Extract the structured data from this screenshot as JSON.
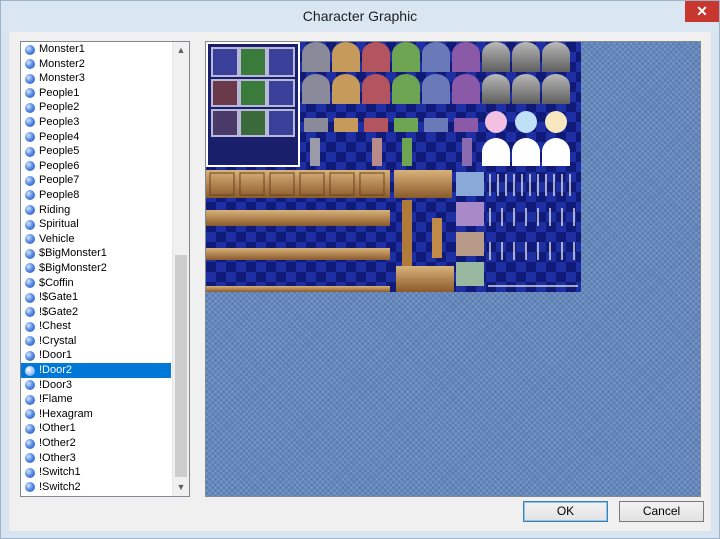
{
  "window": {
    "title": "Character Graphic",
    "close_label": "✕"
  },
  "list": {
    "items": [
      "Monster1",
      "Monster2",
      "Monster3",
      "People1",
      "People2",
      "People3",
      "People4",
      "People5",
      "People6",
      "People7",
      "People8",
      "Riding",
      "Spiritual",
      "Vehicle",
      "$BigMonster1",
      "$BigMonster2",
      "$Coffin",
      "!$Gate1",
      "!$Gate2",
      "!Chest",
      "!Crystal",
      "!Door1",
      "!Door2",
      "!Door3",
      "!Flame",
      "!Hexagram",
      "!Other1",
      "!Other2",
      "!Other3",
      "!Switch1",
      "!Switch2"
    ],
    "selected": "!Door2",
    "scroll_up_icon": "▲",
    "scroll_down_icon": "▼"
  },
  "buttons": {
    "ok_label": "OK",
    "cancel_label": "Cancel"
  },
  "colors": {
    "selection": "#0078d7",
    "preview_background": "#5b7fb5",
    "close_button": "#c7372f"
  }
}
